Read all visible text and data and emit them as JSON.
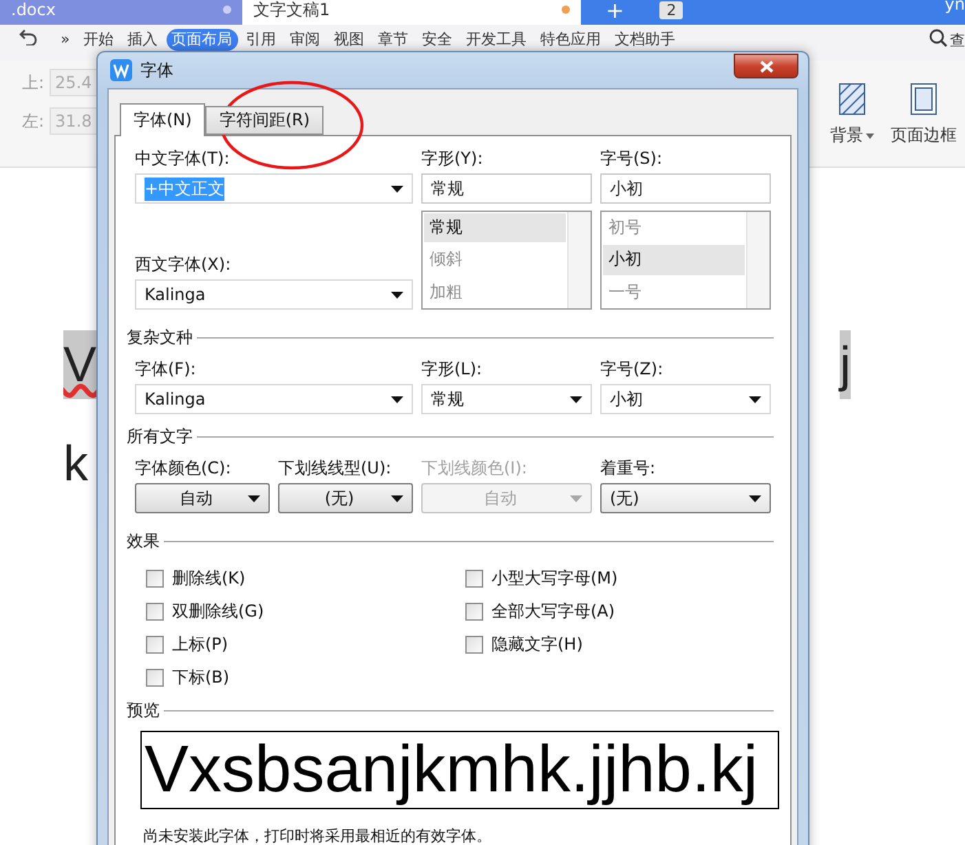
{
  "app": {
    "tabs": [
      {
        "label": ".docx",
        "selected": false
      },
      {
        "label": "文字文稿1",
        "selected": true
      }
    ],
    "new_tab": "+",
    "tab_count": "2",
    "user": "yn",
    "menu": [
      {
        "label": "开始",
        "selected": false
      },
      {
        "label": "插入",
        "selected": false
      },
      {
        "label": "页面布局",
        "selected": true
      },
      {
        "label": "引用",
        "selected": false
      },
      {
        "label": "审阅",
        "selected": false
      },
      {
        "label": "视图",
        "selected": false
      },
      {
        "label": "章节",
        "selected": false
      },
      {
        "label": "安全",
        "selected": false
      },
      {
        "label": "开发工具",
        "selected": false
      },
      {
        "label": "特色应用",
        "selected": false
      },
      {
        "label": "文档助手",
        "selected": false
      }
    ],
    "more": "»",
    "search": "查",
    "margins": [
      {
        "label": "上:",
        "value": "25.4"
      },
      {
        "label": "左:",
        "value": "31.8"
      }
    ],
    "ribbon_tools": [
      {
        "label": "背景",
        "dropdown": true
      },
      {
        "label": "页面边框",
        "dropdown": false
      }
    ],
    "document": [
      {
        "left": "V",
        "right": "j"
      },
      {
        "left": "k"
      }
    ]
  },
  "dialog": {
    "title": "字体",
    "tabs": [
      {
        "label": "字体(N)",
        "selected": true
      },
      {
        "label": "字符间距(R)",
        "selected": false
      }
    ],
    "chinese_font": {
      "label": "中文字体(T):",
      "value": "+中文正文"
    },
    "western_font": {
      "label": "西文字体(X):",
      "value": "Kalinga"
    },
    "style": {
      "label": "字形(Y):",
      "value": "常规",
      "options": [
        {
          "label": "常规",
          "selected": true
        },
        {
          "label": "倾斜",
          "selected": false
        },
        {
          "label": "加粗",
          "selected": false
        }
      ]
    },
    "size": {
      "label": "字号(S):",
      "value": "小初",
      "options": [
        {
          "label": "初号",
          "selected": false
        },
        {
          "label": "小初",
          "selected": true
        },
        {
          "label": "一号",
          "selected": false
        }
      ]
    },
    "complex": {
      "heading": "复杂文种",
      "fields": [
        {
          "label": "字体(F):",
          "value": "Kalinga"
        },
        {
          "label": "字形(L):",
          "value": "常规"
        },
        {
          "label": "字号(Z):",
          "value": "小初"
        }
      ]
    },
    "all_text": {
      "heading": "所有文字",
      "fields": [
        {
          "label": "字体颜色(C):",
          "value": "自动",
          "kind": "button",
          "disabled": false
        },
        {
          "label": "下划线线型(U):",
          "value": "(无)",
          "kind": "button",
          "disabled": false
        },
        {
          "label": "下划线颜色(I):",
          "value": "自动",
          "kind": "button",
          "disabled": true
        },
        {
          "label": "着重号:",
          "value": "(无)",
          "kind": "combo",
          "disabled": false
        }
      ]
    },
    "effects": {
      "heading": "效果",
      "options": [
        {
          "label": "删除线(K)",
          "checked": false
        },
        {
          "label": "双删除线(G)",
          "checked": false
        },
        {
          "label": "上标(P)",
          "checked": false
        },
        {
          "label": "下标(B)",
          "checked": false
        },
        {
          "label": "小型大写字母(M)",
          "checked": false
        },
        {
          "label": "全部大写字母(A)",
          "checked": false
        },
        {
          "label": "隐藏文字(H)",
          "checked": false
        }
      ]
    },
    "preview": {
      "heading": "预览",
      "sample": "Vxsbsanjkmhk.jjhb.kj",
      "note": "尚未安装此字体，打印时将采用最相近的有效字体。"
    }
  }
}
